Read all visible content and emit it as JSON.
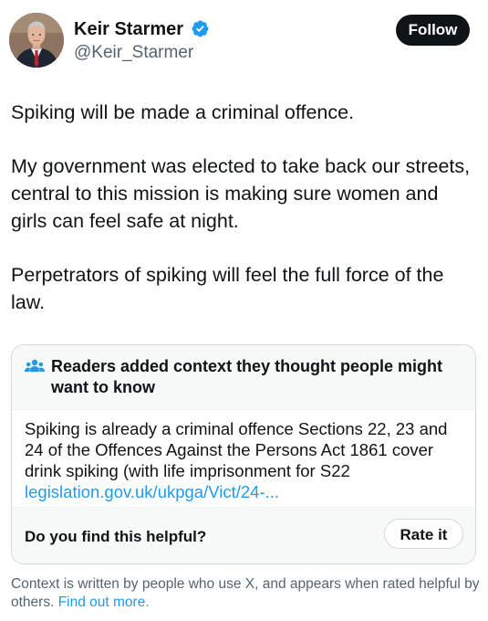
{
  "author": {
    "display_name": "Keir Starmer",
    "handle": "@Keir_Starmer",
    "verified_icon": "verified-badge-icon",
    "avatar_icon": "profile-photo"
  },
  "follow_button": {
    "label": "Follow"
  },
  "tweet": {
    "paragraphs": [
      "Spiking will be made a criminal offence.",
      "My government was elected to take back our streets, central to this mission is making sure women and girls can feel safe at night.",
      "Perpetrators of spiking will feel the full force of the law."
    ]
  },
  "community_note": {
    "icon": "people-icon",
    "title": "Readers added context they thought people might want to know",
    "text": "Spiking is already a criminal offence Sections 22, 23 and 24 of the Offences Against the Persons Act 1861 cover drink spiking (with life imprisonment for S22",
    "link": "legislation.gov.uk/ukpga/Vict/24-...",
    "helpful_question": "Do you find this helpful?",
    "rate_button": "Rate it"
  },
  "disclaimer": {
    "text": "Context is written by people who use X, and appears when rated helpful by others.",
    "link": "Find out more."
  },
  "colors": {
    "accent_link": "#1d9bf0",
    "text_primary": "#0f1419",
    "text_secondary": "#536471",
    "verified_blue": "#1d9bf0",
    "card_background": "#f7f9f9",
    "border": "#cfd9de"
  }
}
